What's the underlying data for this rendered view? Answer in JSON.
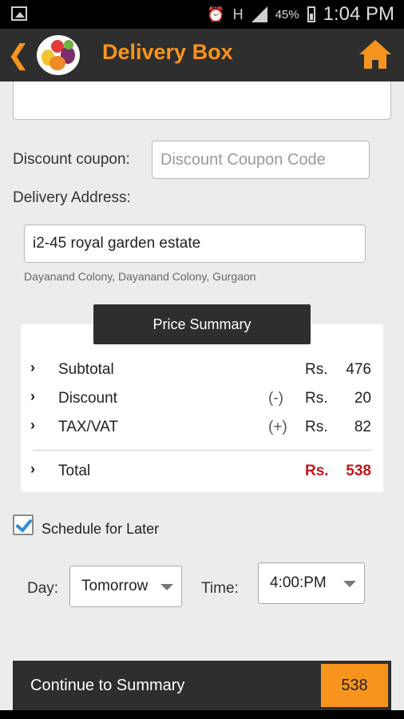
{
  "status_bar": {
    "battery": "45%",
    "time": "1:04 PM",
    "network": "H"
  },
  "header": {
    "title": "Delivery Box"
  },
  "form": {
    "coupon_label": "Discount coupon:",
    "coupon_placeholder": "Discount Coupon Code",
    "address_label": "Delivery Address:",
    "address_value": "i2-45 royal garden estate",
    "address_sub": "Dayanand Colony, Dayanand Colony, Gurgaon"
  },
  "price_summary": {
    "title": "Price Summary",
    "rows": [
      {
        "name": "Subtotal",
        "sign": "",
        "currency": "Rs.",
        "amount": "476"
      },
      {
        "name": "Discount",
        "sign": "(-)",
        "currency": "Rs.",
        "amount": "20"
      },
      {
        "name": "TAX/VAT",
        "sign": "(+)",
        "currency": "Rs.",
        "amount": "82"
      }
    ],
    "total": {
      "name": "Total",
      "currency": "Rs.",
      "amount": "538"
    }
  },
  "schedule": {
    "label": "Schedule for Later",
    "checked": true,
    "day_label": "Day:",
    "day_value": "Tomorrow",
    "time_label": "Time:",
    "time_value": "4:00:PM"
  },
  "footer": {
    "continue_label": "Continue to Summary",
    "total": "538"
  },
  "colors": {
    "accent": "#f7941d",
    "bar": "#2e2e2e",
    "total_red": "#c0161b",
    "check_blue": "#2b8fd8"
  }
}
